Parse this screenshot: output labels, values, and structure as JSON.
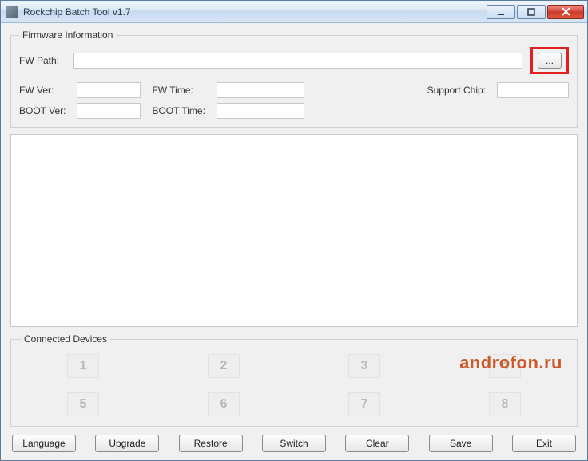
{
  "window": {
    "title": "Rockchip Batch Tool v1.7"
  },
  "firmware": {
    "legend": "Firmware Information",
    "fw_path_label": "FW Path:",
    "fw_path_value": "",
    "browse_label": "...",
    "fw_ver_label": "FW Ver:",
    "fw_ver_value": "",
    "fw_time_label": "FW Time:",
    "fw_time_value": "",
    "support_chip_label": "Support Chip:",
    "support_chip_value": "",
    "boot_ver_label": "BOOT Ver:",
    "boot_ver_value": "",
    "boot_time_label": "BOOT Time:",
    "boot_time_value": ""
  },
  "log": {
    "content": ""
  },
  "devices": {
    "legend": "Connected Devices",
    "slots": [
      "1",
      "2",
      "3",
      "4",
      "5",
      "6",
      "7",
      "8"
    ]
  },
  "watermark": "androfon.ru",
  "buttons": {
    "language": "Language",
    "upgrade": "Upgrade",
    "restore": "Restore",
    "switch": "Switch",
    "clear": "Clear",
    "save": "Save",
    "exit": "Exit"
  },
  "highlight_color": "#e02020"
}
